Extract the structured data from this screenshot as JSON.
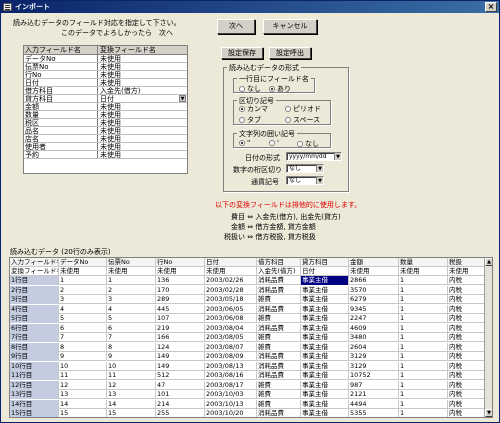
{
  "window": {
    "title": "インポート"
  },
  "instructions": {
    "line1": "読み込むデータのフィールド対応を指定して下さい。",
    "line2": "このデータでよろしかったら　次へ"
  },
  "buttons": {
    "next": "次へ",
    "cancel": "キャンセル",
    "save_settings": "設定保存",
    "load_settings": "設定呼出"
  },
  "mapping": {
    "headers": [
      "入力フィールド名",
      "変換フィールド名"
    ],
    "rows": [
      [
        "データNo",
        "未使用"
      ],
      [
        "伝票No",
        "未使用"
      ],
      [
        "行No",
        "未使用"
      ],
      [
        "日付",
        "未使用"
      ],
      [
        "借方科目",
        "入金先(借方)"
      ],
      [
        "貸方科目",
        "日付"
      ],
      [
        "金額",
        "未使用"
      ],
      [
        "数量",
        "未使用"
      ],
      [
        "税区",
        "未使用"
      ],
      [
        "品名",
        "未使用"
      ],
      [
        "店名",
        "未使用"
      ],
      [
        "使用者",
        "未使用"
      ],
      [
        "予約",
        "未使用"
      ]
    ]
  },
  "format": {
    "title": "読み込むデータの形式",
    "first_row": {
      "label": "一行目にフィールド名",
      "options": [
        "なし",
        "あり"
      ],
      "selected": 1
    },
    "delimiter": {
      "label": "区切り記号",
      "options": [
        "カンマ",
        "ピリオド",
        "タブ",
        "スペース"
      ],
      "selected": 0
    },
    "quote": {
      "label": "文字列の囲い記号",
      "options": [
        "\"",
        "'",
        "なし"
      ],
      "selected": 0
    },
    "date_format": {
      "label": "日付の形式",
      "value": "yyyy/mm/dd"
    },
    "number_sep": {
      "label": "数字の桁区切り",
      "value": "なし"
    },
    "currency": {
      "label": "通貨記号",
      "value": "なし"
    }
  },
  "exclusive_note": {
    "title": "以下の変換フィールドは排他的に使用します。",
    "rows": [
      [
        "費目",
        "⇔",
        "入金先(借方), 出金先(貸方)"
      ],
      [
        "金額",
        "⇔",
        "借方金額, 貸方金額"
      ],
      [
        "税扱い",
        "⇔",
        "借方税扱, 貸方税扱"
      ]
    ]
  },
  "preview": {
    "label": "読み込むデータ (20行のみ表示)",
    "header1": [
      "入力フィールド名",
      "データNo",
      "伝票No",
      "行No",
      "日付",
      "借方科目",
      "貸方科目",
      "金額",
      "数量",
      "税扱"
    ],
    "header2": [
      "変換フィールド名",
      "未使用",
      "未使用",
      "未使用",
      "未使用",
      "入金先(借方)",
      "日付",
      "未使用",
      "未使用",
      "未使用"
    ],
    "rows": [
      [
        "1行目",
        "1",
        "1",
        "136",
        "2003/02/26",
        "消耗品費",
        "事業主借",
        "2866",
        "1",
        "内税"
      ],
      [
        "2行目",
        "2",
        "2",
        "170",
        "2003/02/28",
        "消耗品費",
        "事業主借",
        "3570",
        "1",
        "内税"
      ],
      [
        "3行目",
        "3",
        "3",
        "289",
        "2003/05/18",
        "雑費",
        "事業主借",
        "6279",
        "1",
        "内税"
      ],
      [
        "4行目",
        "4",
        "4",
        "445",
        "2003/06/05",
        "消耗品費",
        "事業主借",
        "9345",
        "1",
        "内税"
      ],
      [
        "5行目",
        "5",
        "5",
        "107",
        "2003/06/08",
        "雑費",
        "事業主借",
        "2247",
        "1",
        "内税"
      ],
      [
        "6行目",
        "6",
        "6",
        "219",
        "2003/08/04",
        "消耗品費",
        "事業主借",
        "4609",
        "1",
        "内税"
      ],
      [
        "7行目",
        "7",
        "7",
        "166",
        "2003/08/05",
        "雑費",
        "事業主借",
        "3480",
        "1",
        "内税"
      ],
      [
        "8行目",
        "8",
        "8",
        "124",
        "2003/08/07",
        "雑費",
        "事業主借",
        "2604",
        "1",
        "内税"
      ],
      [
        "9行目",
        "9",
        "9",
        "149",
        "2003/08/09",
        "消耗品費",
        "事業主借",
        "3129",
        "1",
        "内税"
      ],
      [
        "10行目",
        "10",
        "10",
        "149",
        "2003/08/13",
        "消耗品費",
        "事業主借",
        "3129",
        "1",
        "内税"
      ],
      [
        "11行目",
        "11",
        "11",
        "512",
        "2003/08/16",
        "消耗品費",
        "事業主借",
        "10752",
        "1",
        "内税"
      ],
      [
        "12行目",
        "12",
        "12",
        "47",
        "2003/08/17",
        "雑費",
        "事業主借",
        "987",
        "1",
        "内税"
      ],
      [
        "13行目",
        "13",
        "13",
        "101",
        "2003/10/03",
        "雑費",
        "事業主借",
        "2121",
        "1",
        "内税"
      ],
      [
        "14行目",
        "14",
        "14",
        "214",
        "2003/10/13",
        "雑費",
        "事業主借",
        "4494",
        "1",
        "内税"
      ],
      [
        "15行目",
        "15",
        "15",
        "255",
        "2003/10/20",
        "消耗品費",
        "事業主借",
        "5355",
        "1",
        "内税"
      ]
    ]
  }
}
